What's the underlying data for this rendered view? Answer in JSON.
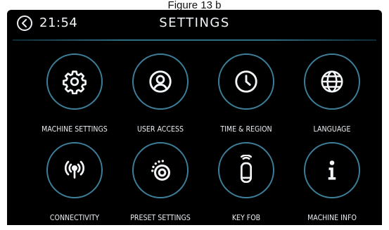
{
  "caption": "Figure 13 b",
  "header": {
    "time": "21:54",
    "title": "SETTINGS"
  },
  "tiles": [
    {
      "label": "MACHINE SETTINGS",
      "icon": "gear-icon"
    },
    {
      "label": "USER ACCESS",
      "icon": "user-icon"
    },
    {
      "label": "TIME & REGION",
      "icon": "clock-icon"
    },
    {
      "label": "LANGUAGE",
      "icon": "globe-icon"
    },
    {
      "label": "CONNECTIVITY",
      "icon": "wireless-signal-icon"
    },
    {
      "label": "PRESET SETTINGS",
      "icon": "preset-dial-icon"
    },
    {
      "label": "KEY FOB",
      "icon": "key-fob-icon"
    },
    {
      "label": "MACHINE INFO",
      "icon": "info-icon"
    }
  ],
  "colors": {
    "background": "#000000",
    "accent_ring": "#3d7f9a",
    "text": "#e9eef2"
  }
}
